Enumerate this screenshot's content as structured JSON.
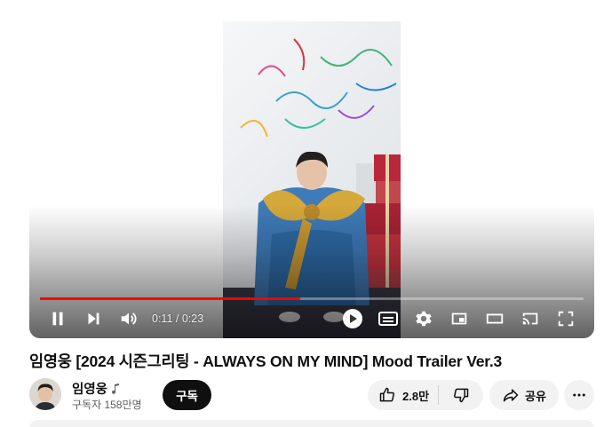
{
  "player": {
    "time_display": "0:11 / 0:23",
    "progress_fraction": 0.478,
    "accent_color": "#ff0000",
    "icons": [
      "pause-icon",
      "next-icon",
      "volume-icon",
      "autoplay-icon",
      "captions-icon",
      "settings-icon",
      "miniplayer-icon",
      "theater-icon",
      "cast-icon",
      "fullscreen-icon"
    ]
  },
  "video": {
    "title": "임영웅 [2024 시즌그리팅 - ALWAYS ON MY MIND] Mood Trailer Ver.3"
  },
  "channel": {
    "name": "임영웅",
    "subscribers": "구독자 158만명",
    "subscribe_label": "구독",
    "badge_icon": "music-note-icon"
  },
  "actions": {
    "like_count": "2.8만",
    "share_label": "공유"
  }
}
